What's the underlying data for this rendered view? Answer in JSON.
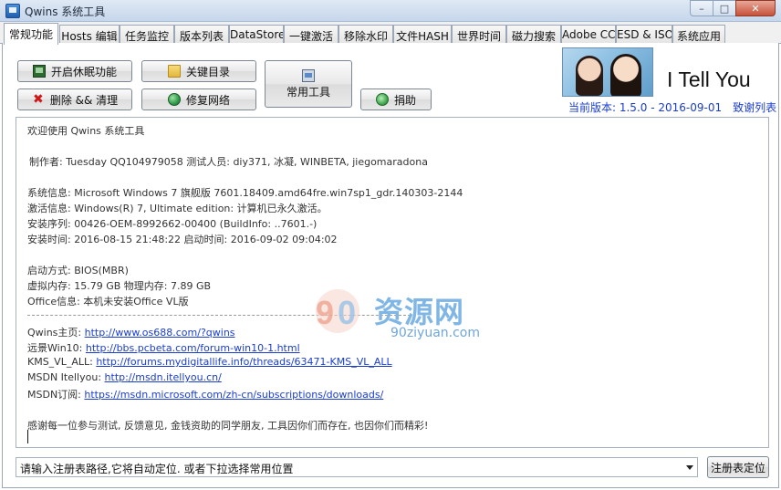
{
  "window": {
    "title": "Qwins 系统工具",
    "buttons": {
      "minimize": "–",
      "maximize": "□",
      "close": "✕"
    }
  },
  "tabs": [
    {
      "label": "常规功能",
      "active": true
    },
    {
      "label": "Hosts 编辑"
    },
    {
      "label": "任务监控"
    },
    {
      "label": "版本列表"
    },
    {
      "label": "DataStore"
    },
    {
      "label": "一键激活"
    },
    {
      "label": "移除水印"
    },
    {
      "label": "文件HASH"
    },
    {
      "label": "世界时间"
    },
    {
      "label": "磁力搜索"
    },
    {
      "label": "Adobe CC"
    },
    {
      "label": "ESD & ISO"
    },
    {
      "label": "系统应用"
    }
  ],
  "buttons": {
    "hibernate": "开启休眠功能",
    "key_dirs": "关键目录",
    "common_tools": "常用工具",
    "delete_clean": "删除 && 清理",
    "repair_network": "修复网络",
    "donate": "捐助"
  },
  "banner": {
    "title": "I Tell You",
    "version": "当前版本: 1.5.0 - 2016-09-01",
    "thanks": "致谢列表"
  },
  "info": {
    "welcome": "欢迎使用 Qwins 系统工具",
    "author": "制作者: Tuesday QQ104979058 测试人员: diy371, 冰凝, WINBETA, jiegomaradona",
    "sys_info": "系统信息: Microsoft Windows 7 旗舰版  7601.18409.amd64fre.win7sp1_gdr.140303-2144",
    "activation": "激活信息: Windows(R) 7, Ultimate edition:  计算机已永久激活。",
    "install_serial": "安装序列: 00426-OEM-8992662-00400 (BuildInfo: ..7601.-)",
    "install_time": "安装时间: 2016-08-15 21:48:22 启动时间: 2016-09-02 09:04:02",
    "boot_mode": "启动方式: BIOS(MBR)",
    "memory": "虚拟内存: 15.79 GB 物理内存: 7.89 GB",
    "office": "Office信息: 本机未安装Office VL版",
    "links": [
      {
        "label": "Qwins主页: ",
        "url": "http://www.os688.com/?qwins"
      },
      {
        "label": "远景Win10:  ",
        "url": "http://bbs.pcbeta.com/forum-win10-1.html"
      },
      {
        "label": "KMS_VL_ALL: ",
        "url": "http://forums.mydigitallife.info/threads/63471-KMS_VL_ALL"
      },
      {
        "label": "MSDN Itellyou: ",
        "url": "http://msdn.itellyou.cn/"
      },
      {
        "label": "MSDN订阅: ",
        "url": "https://msdn.microsoft.com/zh-cn/subscriptions/downloads/"
      }
    ],
    "thanks_note": "感谢每一位参与测试, 反馈意见, 金钱资助的同学朋友, 工具因你们而存在, 也因你们而精彩!"
  },
  "watermark": {
    "cn": "资源网",
    "en": "90ziyuan.com"
  },
  "registry": {
    "placeholder": "请输入注册表路径,它将自动定位. 或者下拉选择常用位置",
    "locate_button": "注册表定位"
  }
}
